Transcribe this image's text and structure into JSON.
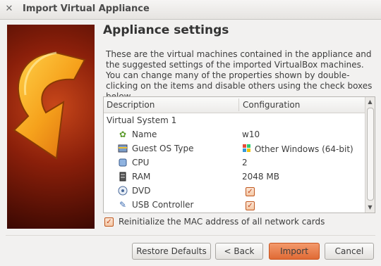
{
  "window": {
    "title": "Import Virtual Appliance",
    "close_glyph": "✕"
  },
  "page": {
    "heading": "Appliance settings",
    "description": "These are the virtual machines contained in the appliance and the suggested settings of the imported VirtualBox machines. You can change many of the properties shown by double-clicking on the items and disable others using the check boxes below."
  },
  "tree": {
    "col_description": "Description",
    "col_configuration": "Configuration",
    "group_label": "Virtual System 1",
    "rows": [
      {
        "label": "Name",
        "value": "w10",
        "icon": "name-icon"
      },
      {
        "label": "Guest OS Type",
        "value": "Other Windows (64-bit)",
        "icon": "os-type-icon"
      },
      {
        "label": "CPU",
        "value": "2",
        "icon": "cpu-icon"
      },
      {
        "label": "RAM",
        "value": "2048 MB",
        "icon": "ram-icon"
      },
      {
        "label": "DVD",
        "value": "",
        "icon": "dvd-icon",
        "checked": true
      },
      {
        "label": "USB Controller",
        "value": "",
        "icon": "usb-icon",
        "checked": true
      }
    ]
  },
  "mac_option": {
    "label": "Reinitialize the MAC address of all network cards",
    "checked": true
  },
  "buttons": {
    "restore": "Restore Defaults",
    "back": "< Back",
    "import": "Import",
    "cancel": "Cancel"
  }
}
